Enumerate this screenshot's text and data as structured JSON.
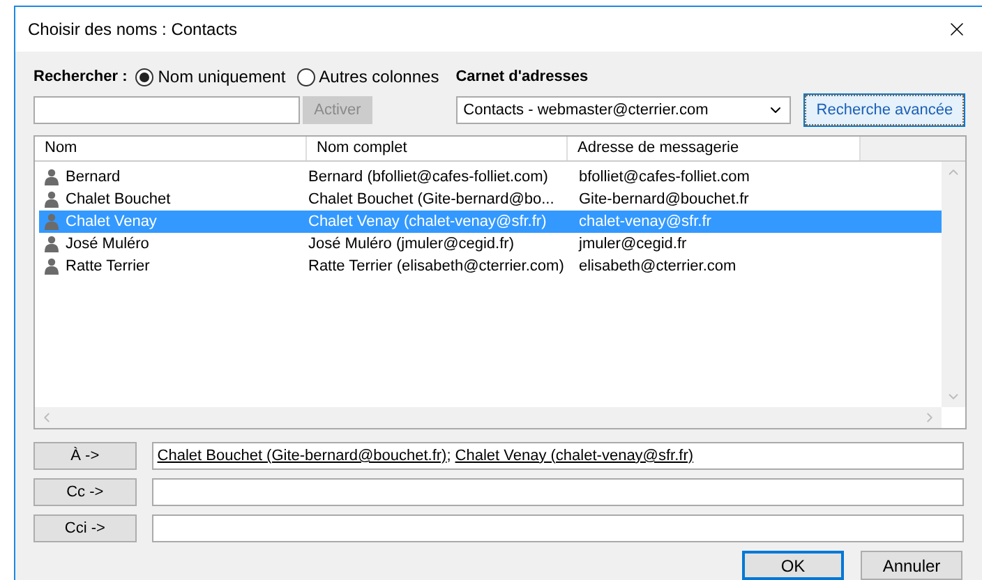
{
  "window": {
    "title": "Choisir des noms : Contacts"
  },
  "search": {
    "label": "Rechercher :",
    "options": [
      {
        "label": "Nom uniquement",
        "selected": true
      },
      {
        "label": "Autres colonnes",
        "selected": false
      }
    ],
    "go_button": {
      "label": "Activer",
      "disabled": true
    }
  },
  "address_book": {
    "label": "Carnet d'adresses",
    "value": "Contacts - webmaster@cterrier.com",
    "advanced_button": "Recherche avancée"
  },
  "table": {
    "columns": [
      "Nom",
      "Nom complet",
      "Adresse de messagerie"
    ],
    "rows": [
      {
        "name": "Bernard",
        "full_name": "Bernard (bfolliet@cafes-folliet.com)",
        "email": "bfolliet@cafes-folliet.com",
        "selected": false
      },
      {
        "name": "Chalet Bouchet",
        "full_name": "Chalet Bouchet (Gite-bernard@bo...",
        "email": "Gite-bernard@bouchet.fr",
        "selected": false
      },
      {
        "name": "Chalet Venay",
        "full_name": "Chalet Venay (chalet-venay@sfr.fr)",
        "email": "chalet-venay@sfr.fr",
        "selected": true
      },
      {
        "name": "José Muléro",
        "full_name": "José Muléro (jmuler@cegid.fr)",
        "email": "jmuler@cegid.fr",
        "selected": false
      },
      {
        "name": "Ratte Terrier",
        "full_name": "Ratte Terrier (elisabeth@cterrier.com)",
        "email": "elisabeth@cterrier.com",
        "selected": false
      }
    ]
  },
  "recipients": [
    {
      "button": "À ->",
      "separator": ";",
      "entries": [
        "Chalet Bouchet (Gite-bernard@bouchet.fr)",
        "Chalet Venay (chalet-venay@sfr.fr)"
      ]
    },
    {
      "button": "Cc ->"
    },
    {
      "button": "Cci ->"
    }
  ],
  "buttons": [
    {
      "label": "OK",
      "default": true
    },
    {
      "label": "Annuler",
      "default": false
    }
  ]
}
